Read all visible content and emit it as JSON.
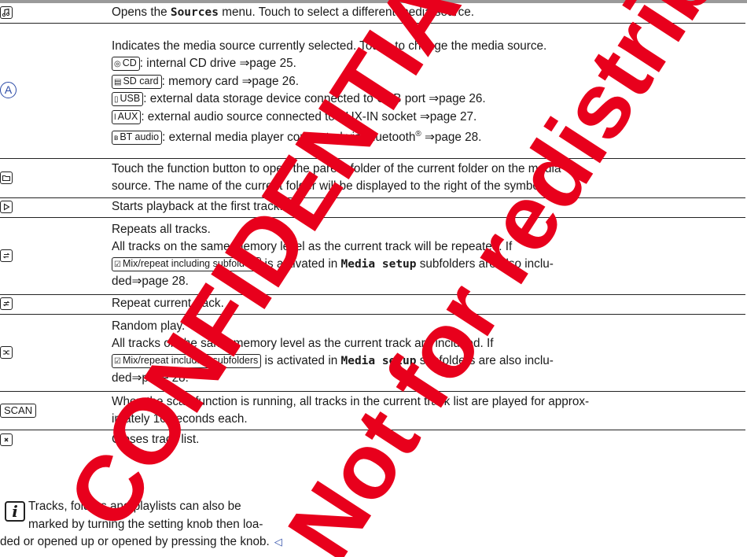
{
  "rows": {
    "sources": {
      "icon": "music-note-icon",
      "desc_a": "Opens the ",
      "desc_b": "Sources",
      "desc_c": " menu. Touch to select a different media source."
    },
    "source_a": {
      "marker": "A",
      "l1": "Indicates the media source currently selected. Touch to change the media source.",
      "cd_btn": "CD",
      "cd_text": ": internal CD drive ⇒page 25.",
      "sd_btn": "SD card",
      "sd_text": ": memory card ⇒page 26.",
      "usb_btn": "USB",
      "usb_text": ": external data storage device connected to USB port ⇒page 26.",
      "aux_btn": "AUX",
      "aux_text": ": external audio source connected to AUX-IN socket ⇒page 27.",
      "bt_btn": "BT audio",
      "bt_text_a": ": external media player connected via Bluetooth",
      "bt_sup": "®",
      "bt_text_b": " ⇒page 28."
    },
    "folder": {
      "icon": "folder-icon",
      "l1": "Touch the function button to open the parent folder of the current folder on the media",
      "l2": "source. The name of the current folder will be displayed to the right of the symbol."
    },
    "play": {
      "icon": "play-icon",
      "l1": "Starts playback at the first track."
    },
    "repeat_all": {
      "icon": "repeat-icon",
      "l1": "Repeats all tracks.",
      "l2": "All tracks on the same memory level as the current track will be repeated. If",
      "btn": "Mix/repeat including subfolders",
      "l3a": " is activated in ",
      "l3b": "Media setup",
      "l3c": " subfolders are also inclu-",
      "l4": "ded⇒page 28."
    },
    "repeat_one": {
      "icon": "repeat-one-icon",
      "l1": "Repeat current track."
    },
    "random": {
      "icon": "shuffle-icon",
      "l1": "Random play.",
      "l2": "All tracks on the same memory level as the current track are included. If",
      "btn": "Mix/repeat including subfolders",
      "l3a": " is activated in ",
      "l3b": "Media setup",
      "l3c": " subfolders are also inclu-",
      "l4": "ded⇒page 28."
    },
    "scan": {
      "btn": "SCAN",
      "l1": "When the scan function is running, all tracks in the current track list are played for approx-",
      "l2": "imately 10 seconds each."
    },
    "close": {
      "icon": "close-icon",
      "l1": "Closes track list."
    }
  },
  "note": {
    "icon": "info-icon",
    "l1": "Tracks, folders and playlists can also be",
    "l2": "marked by turning the setting knob then loa-",
    "l3": "ded or opened up or opened by pressing the knob.",
    "end_mark": "◁"
  },
  "watermark": {
    "line1": "CONFIDENTIAL",
    "line2": "Not for redistribution",
    "color": "#e8001c"
  },
  "colors": {
    "accent": "#2b4aa6",
    "rule": "#222222"
  }
}
